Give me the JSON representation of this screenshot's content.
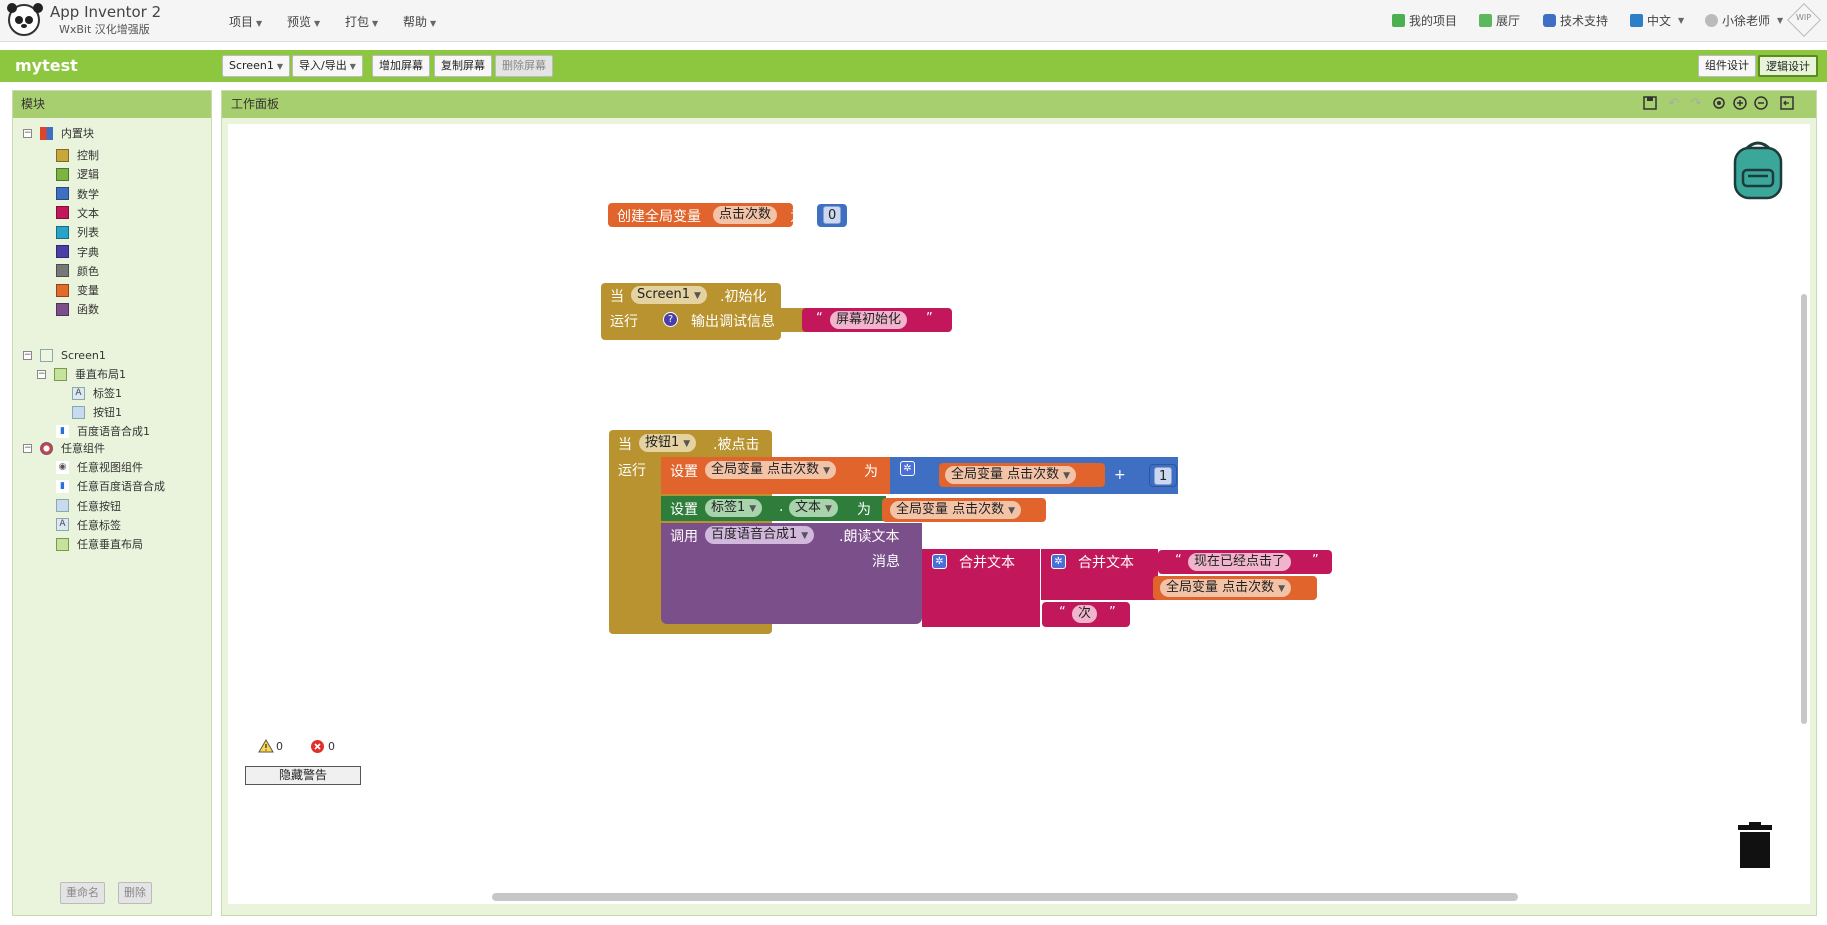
{
  "app": {
    "title": "App Inventor 2",
    "subtitle": "WxBit 汉化增强版"
  },
  "menu": [
    {
      "label": "项目"
    },
    {
      "label": "预览"
    },
    {
      "label": "打包"
    },
    {
      "label": "帮助"
    }
  ],
  "top_right": {
    "my_projects": "我的项目",
    "gallery": "展厅",
    "support": "技术支持",
    "language": "中文",
    "user": "小徐老师",
    "badge": "WIP"
  },
  "project": {
    "name": "mytest",
    "screen_select": "Screen1",
    "import_export": "导入/导出",
    "add_screen": "增加屏幕",
    "copy_screen": "复制屏幕",
    "delete_screen": "删除屏幕",
    "designer": "组件设计",
    "blocks_editor": "逻辑设计"
  },
  "blocks_panel": {
    "title": "模块",
    "builtin": "内置块",
    "categories": [
      {
        "label": "控制",
        "color": "#c8a63a"
      },
      {
        "label": "逻辑",
        "color": "#7cb342"
      },
      {
        "label": "数学",
        "color": "#3f6fc2"
      },
      {
        "label": "文本",
        "color": "#c2185b"
      },
      {
        "label": "列表",
        "color": "#29a3c7"
      },
      {
        "label": "字典",
        "color": "#4a3fa8"
      },
      {
        "label": "颜色",
        "color": "#777777"
      },
      {
        "label": "变量",
        "color": "#e06b2b"
      },
      {
        "label": "函数",
        "color": "#7b4f8a"
      }
    ],
    "screen": "Screen1",
    "layout": "垂直布局1",
    "label1": "标签1",
    "button1": "按钮1",
    "tts": "百度语音合成1",
    "any_group": "任意组件",
    "any_items": [
      {
        "label": "任意视图组件",
        "icon": "eye-icon"
      },
      {
        "label": "任意百度语音合成",
        "icon": "tts-icon"
      },
      {
        "label": "任意按钮",
        "icon": "button-icon"
      },
      {
        "label": "任意标签",
        "icon": "label-icon"
      },
      {
        "label": "任意垂直布局",
        "icon": "layout-icon"
      }
    ],
    "rename": "重命名",
    "delete": "删除"
  },
  "workspace": {
    "title": "工作面板",
    "warnings_count": "0",
    "errors_count": "0",
    "hide_warnings": "隐藏警告"
  },
  "code_blocks": {
    "global_decl": {
      "prefix": "创建全局变量",
      "name": "点击次数",
      "as": "为",
      "value": "0"
    },
    "screen_init": {
      "when": "当",
      "component": "Screen1",
      "event": ".初始化",
      "do": "运行",
      "log": "输出调试信息",
      "text": "屏幕初始化"
    },
    "button_click": {
      "when": "当",
      "component": "按钮1",
      "event": ".被点击",
      "do": "运行",
      "set": "设置",
      "global_var": "全局变量 点击次数",
      "to": "为",
      "plus": "+",
      "increment": "1",
      "set2": "设置",
      "label": "标签1",
      "dot": ".",
      "property": "文本",
      "to2": "为",
      "call": "调用",
      "tts": "百度语音合成1",
      "method": ".朗读文本",
      "message": "消息",
      "join": "合并文本",
      "join2": "合并文本",
      "text1": "现在已经点击了",
      "text2": "次"
    }
  }
}
